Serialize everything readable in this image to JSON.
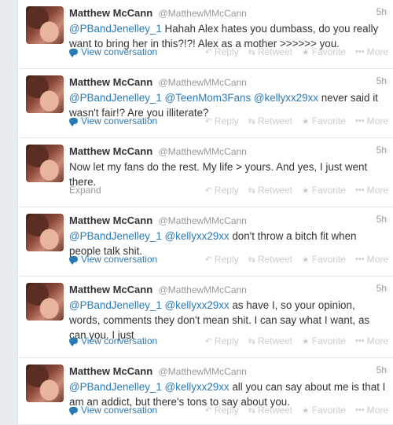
{
  "colors": {
    "link": "#2a7ab8",
    "muted": "#999999",
    "action": "#cccccc",
    "text": "#333333"
  },
  "actions": {
    "reply": "Reply",
    "retweet": "Retweet",
    "favorite": "Favorite",
    "more": "More"
  },
  "tweets": [
    {
      "name": "Matthew McCann",
      "handle": "@MatthewMMcCann",
      "time": "5h",
      "segments": [
        {
          "type": "mention",
          "text": "@PBandJenelley_1"
        },
        {
          "type": "text",
          "text": " Hahah Alex hates you dumbass, do you really want to bring her in this?!?! Alex as a mother >>>>>> you."
        }
      ],
      "footer": "View conversation",
      "footer_type": "conversation"
    },
    {
      "name": "Matthew McCann",
      "handle": "@MatthewMMcCann",
      "time": "5h",
      "segments": [
        {
          "type": "mention",
          "text": "@PBandJenelley_1"
        },
        {
          "type": "text",
          "text": " "
        },
        {
          "type": "mention",
          "text": "@TeenMom3Fans"
        },
        {
          "type": "text",
          "text": " "
        },
        {
          "type": "mention",
          "text": "@kellyxx29xx"
        },
        {
          "type": "text",
          "text": " never said it wasn't fair!? Are you illiterate?"
        }
      ],
      "footer": "View conversation",
      "footer_type": "conversation"
    },
    {
      "name": "Matthew McCann",
      "handle": "@MatthewMMcCann",
      "time": "5h",
      "segments": [
        {
          "type": "text",
          "text": "Now let my fans do the rest. My life > yours. And yes, I just went there."
        }
      ],
      "footer": "Expand",
      "footer_type": "expand"
    },
    {
      "name": "Matthew McCann",
      "handle": "@MatthewMMcCann",
      "time": "5h",
      "segments": [
        {
          "type": "mention",
          "text": "@PBandJenelley_1"
        },
        {
          "type": "text",
          "text": " "
        },
        {
          "type": "mention",
          "text": "@kellyxx29xx"
        },
        {
          "type": "text",
          "text": " don't throw a bitch fit when people talk shit."
        }
      ],
      "footer": "View conversation",
      "footer_type": "conversation"
    },
    {
      "name": "Matthew McCann",
      "handle": "@MatthewMMcCann",
      "time": "5h",
      "segments": [
        {
          "type": "mention",
          "text": "@PBandJenelley_1"
        },
        {
          "type": "text",
          "text": " "
        },
        {
          "type": "mention",
          "text": "@kellyxx29xx"
        },
        {
          "type": "text",
          "text": " as have I, so your opinion, words, comments they don't mean shit. I can say what I want, as can you. I just"
        }
      ],
      "footer": "View conversation",
      "footer_type": "conversation"
    },
    {
      "name": "Matthew McCann",
      "handle": "@MatthewMMcCann",
      "time": "5h",
      "segments": [
        {
          "type": "mention",
          "text": "@PBandJenelley_1"
        },
        {
          "type": "text",
          "text": " "
        },
        {
          "type": "mention",
          "text": "@kellyxx29xx"
        },
        {
          "type": "text",
          "text": " all you can say about me is that I am an addict, but there's tons to say about you."
        }
      ],
      "footer": "View conversation",
      "footer_type": "conversation"
    }
  ]
}
